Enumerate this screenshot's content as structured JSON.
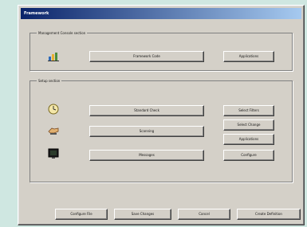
{
  "window": {
    "title": "Framework"
  },
  "group1": {
    "label": "Management Console section",
    "main_button": "Framework Code",
    "side_button": "Applications"
  },
  "group2": {
    "label": "Setup section",
    "rows": [
      {
        "main": "Standard Check",
        "side": "Select Filters",
        "icon": "clock-icon"
      },
      {
        "main": "Scanning",
        "side": "Select Change",
        "icon": "hand-icon"
      },
      {
        "main": "Messages",
        "side": "Applications",
        "icon": "monitor-icon"
      }
    ],
    "extra_side": "Configure"
  },
  "footer": {
    "buttons": [
      "Configure File",
      "Save Changes",
      "Cancel",
      "Create Definition"
    ]
  },
  "colors": {
    "titlebar_start": "#0a246a",
    "titlebar_end": "#a6caf0",
    "window_bg": "#d4d0c8",
    "desktop_bg": "#cfe7e1"
  }
}
